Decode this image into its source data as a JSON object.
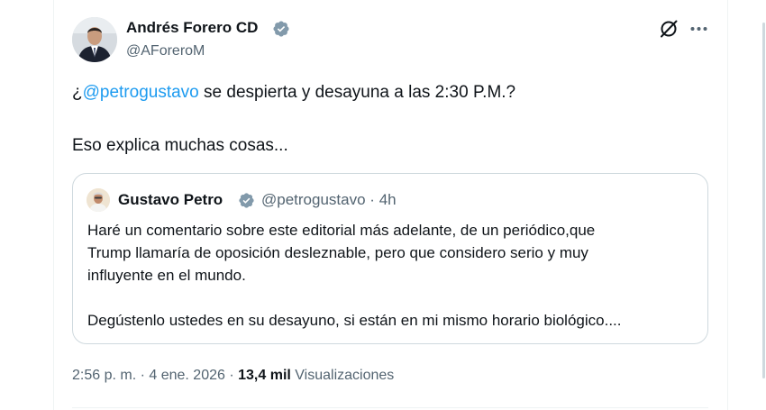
{
  "tweet": {
    "author": {
      "name": "Andrés Forero CD",
      "handle": "@AForeroM"
    },
    "text": {
      "line1_prefix": "¿",
      "line1_mention": "@petrogustavo",
      "line1_suffix": " se despierta y desayuna a las 2:30 P.M.?",
      "line2": "Eso explica muchas cosas..."
    },
    "quoted": {
      "name": "Gustavo Petro",
      "handle": "@petrogustavo",
      "separator": "·",
      "time": "4h",
      "lines": [
        "Haré un comentario sobre este editorial más adelante, de un periódico,que",
        "Trump llamaría de oposición desleznable, pero que considero serio y muy",
        "influyente en el mundo.",
        "Degústenlo ustedes en su desayuno, si están en mi mismo horario biológico...."
      ]
    },
    "meta": {
      "time": "2:56 p. m.",
      "sep1": " · ",
      "date": "4 ene. 2026",
      "sep2": " · ",
      "views_count": "13,4 mil",
      "views_label": " Visualizaciones"
    }
  },
  "colors": {
    "accent": "#1d9bf0",
    "secondary_text": "#536471",
    "primary_text": "#0f1419",
    "border": "#cfd9de",
    "verified": "#829aab"
  },
  "icons": {
    "verified": "verified-badge-icon",
    "grok": "grok-icon",
    "more": "more-icon"
  }
}
